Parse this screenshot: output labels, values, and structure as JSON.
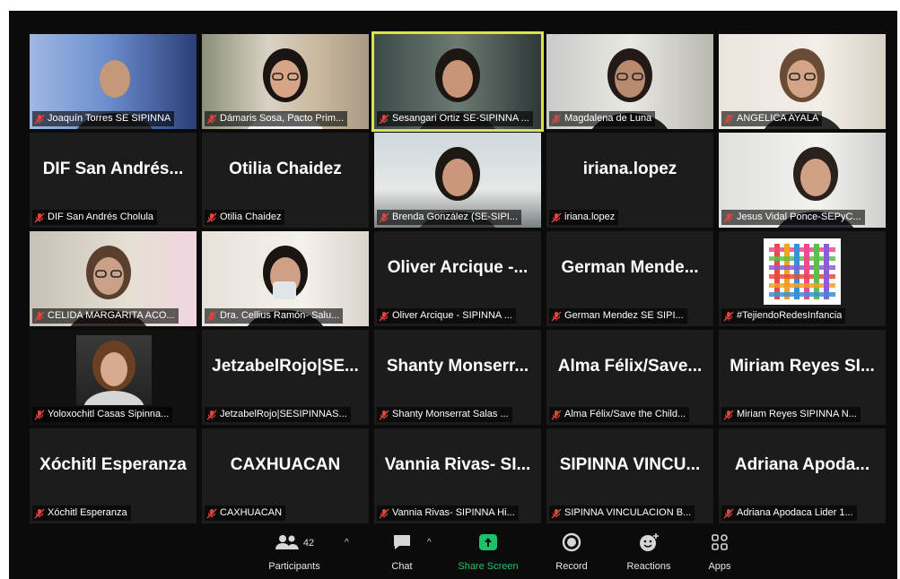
{
  "tiles": [
    {
      "name": "Joaquín Torres SE SIPINNA",
      "video": "man-bald-blue"
    },
    {
      "name": "Dámaris Sosa, Pacto Prim...",
      "video": "woman-glasses-home"
    },
    {
      "name": "Sesangari Ortiz SE-SIPINNA ...",
      "video": "woman-dark-hair",
      "active": true
    },
    {
      "name": "Magdalena de Luna",
      "video": "woman-earphones"
    },
    {
      "name": "ANGELICA AYALA",
      "video": "woman-glasses-short"
    },
    {
      "name": "DIF San Andrés Cholula",
      "display": "DIF San Andrés..."
    },
    {
      "name": "Otilia Chaidez",
      "display": "Otilia Chaidez"
    },
    {
      "name": "Brenda González (SE-SIPI...",
      "video": "woman-office"
    },
    {
      "name": "iriana.lopez",
      "display": "iriana.lopez"
    },
    {
      "name": "Jesus Vidal Ponce-SEPyC...",
      "video": "man-frames-wall"
    },
    {
      "name": "CELIDA MARGARITA ACO...",
      "video": "woman-glasses-room"
    },
    {
      "name": "Dra. Cellius Ramón- Salu...",
      "video": "woman-mug"
    },
    {
      "name": "Oliver Arcique - SIPINNA ...",
      "display": "Oliver Arcique -..."
    },
    {
      "name": "German Mendez SE SIPI...",
      "display": "German Mende..."
    },
    {
      "name": "#TejiendoRedesInfancia",
      "video": "logo"
    },
    {
      "name": "Yoloxochitl Casas Sipinna...",
      "video": "woman-curly"
    },
    {
      "name": "JetzabelRojo|SESIPINNAS...",
      "display": "JetzabelRojo|SE..."
    },
    {
      "name": "Shanty Monserrat Salas ...",
      "display": "Shanty Monserr..."
    },
    {
      "name": "Alma Félix/Save the Child...",
      "display": "Alma Félix/Save..."
    },
    {
      "name": "Miriam Reyes SIPINNA N...",
      "display": "Miriam Reyes SI..."
    },
    {
      "name": "Xóchitl Esperanza",
      "display": "Xóchitl Esperanza"
    },
    {
      "name": "CAXHUACAN",
      "display": "CAXHUACAN"
    },
    {
      "name": "Vannia Rivas- SIPINNA Hi...",
      "display": "Vannia Rivas- SI..."
    },
    {
      "name": "SIPINNA VINCULACION B...",
      "display": "SIPINNA VINCU..."
    },
    {
      "name": "Adriana Apodaca Lider 1...",
      "display": "Adriana Apoda..."
    }
  ],
  "toolbar": {
    "participants_label": "Participants",
    "participants_count": "42",
    "chat_label": "Chat",
    "share_label": "Share Screen",
    "record_label": "Record",
    "reactions_label": "Reactions",
    "apps_label": "Apps",
    "share_color": "#1ec26b"
  },
  "colors": {
    "muted_mic": "#e0443b",
    "active_border": "#d8e44a",
    "tile_bg": "#1c1c1c"
  }
}
